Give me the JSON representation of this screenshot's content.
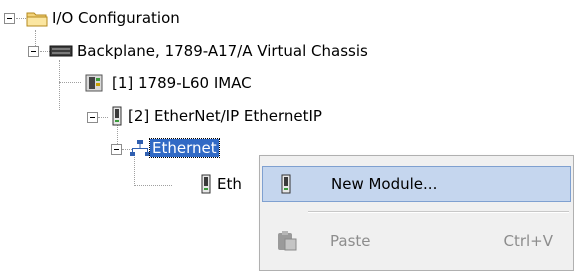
{
  "tree": {
    "root": {
      "label": "I/O Configuration",
      "icon": "folder-icon"
    },
    "backplane": {
      "label": "Backplane, 1789-A17/A Virtual Chassis",
      "icon": "chassis-icon"
    },
    "slot1": {
      "label": "[1] 1789-L60 IMAC",
      "icon": "controller-module-icon"
    },
    "slot2": {
      "label": "[2] EtherNet/IP EthernetIP",
      "icon": "module-icon"
    },
    "ethernet": {
      "label": "Ethernet",
      "icon": "network-icon"
    },
    "child": {
      "label": "Eth",
      "icon": "module-icon"
    }
  },
  "context_menu": {
    "items": [
      {
        "label": "New Module...",
        "shortcut": "",
        "icon": "module-icon",
        "enabled": true,
        "highlighted": true
      },
      {
        "label": "Paste",
        "shortcut": "Ctrl+V",
        "icon": "paste-icon",
        "enabled": false,
        "highlighted": false
      }
    ]
  },
  "colors": {
    "selection": "#316ac5",
    "menu_highlight": "#c5d6ee",
    "disabled_text": "#8d8d8d"
  }
}
